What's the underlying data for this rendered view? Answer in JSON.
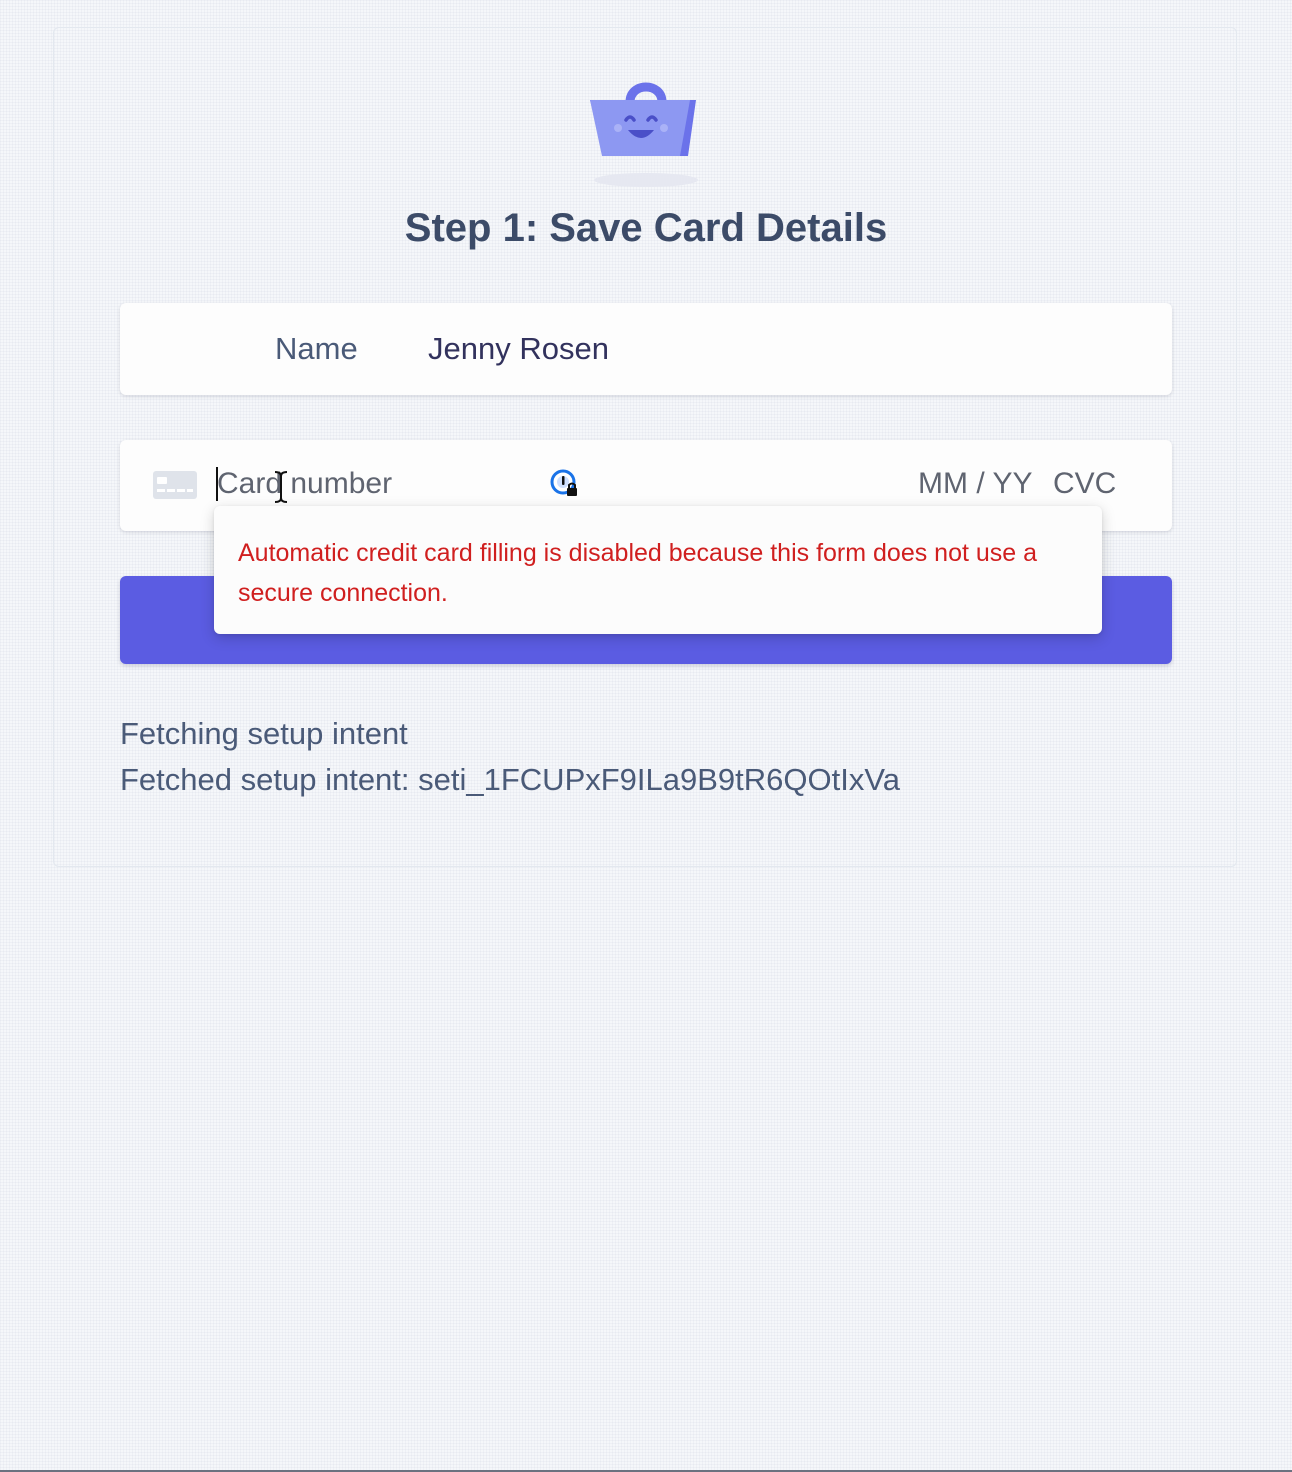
{
  "header": {
    "title": "Step 1: Save Card Details",
    "logo_icon": "shopping-basket-smile-icon"
  },
  "form": {
    "name": {
      "label": "Name",
      "value": "Jenny Rosen"
    },
    "card": {
      "brand_icon": "credit-card-icon",
      "number_placeholder": "Card number",
      "autofill_icon": "password-manager-lock-icon",
      "expiry_placeholder": "MM / YY",
      "cvc_placeholder": "CVC"
    },
    "submit": {
      "label": ""
    }
  },
  "autofill_tooltip": {
    "message": "Automatic credit card filling is disabled because this form does not use a secure connection."
  },
  "status": {
    "lines": [
      "Fetching setup intent",
      "Fetched setup intent: seti_1FCUPxF9ILa9B9tR6QOtIxVa"
    ]
  },
  "colors": {
    "accent": "#5b5ce2",
    "title": "#3c4b68",
    "error": "#d01f1f"
  }
}
